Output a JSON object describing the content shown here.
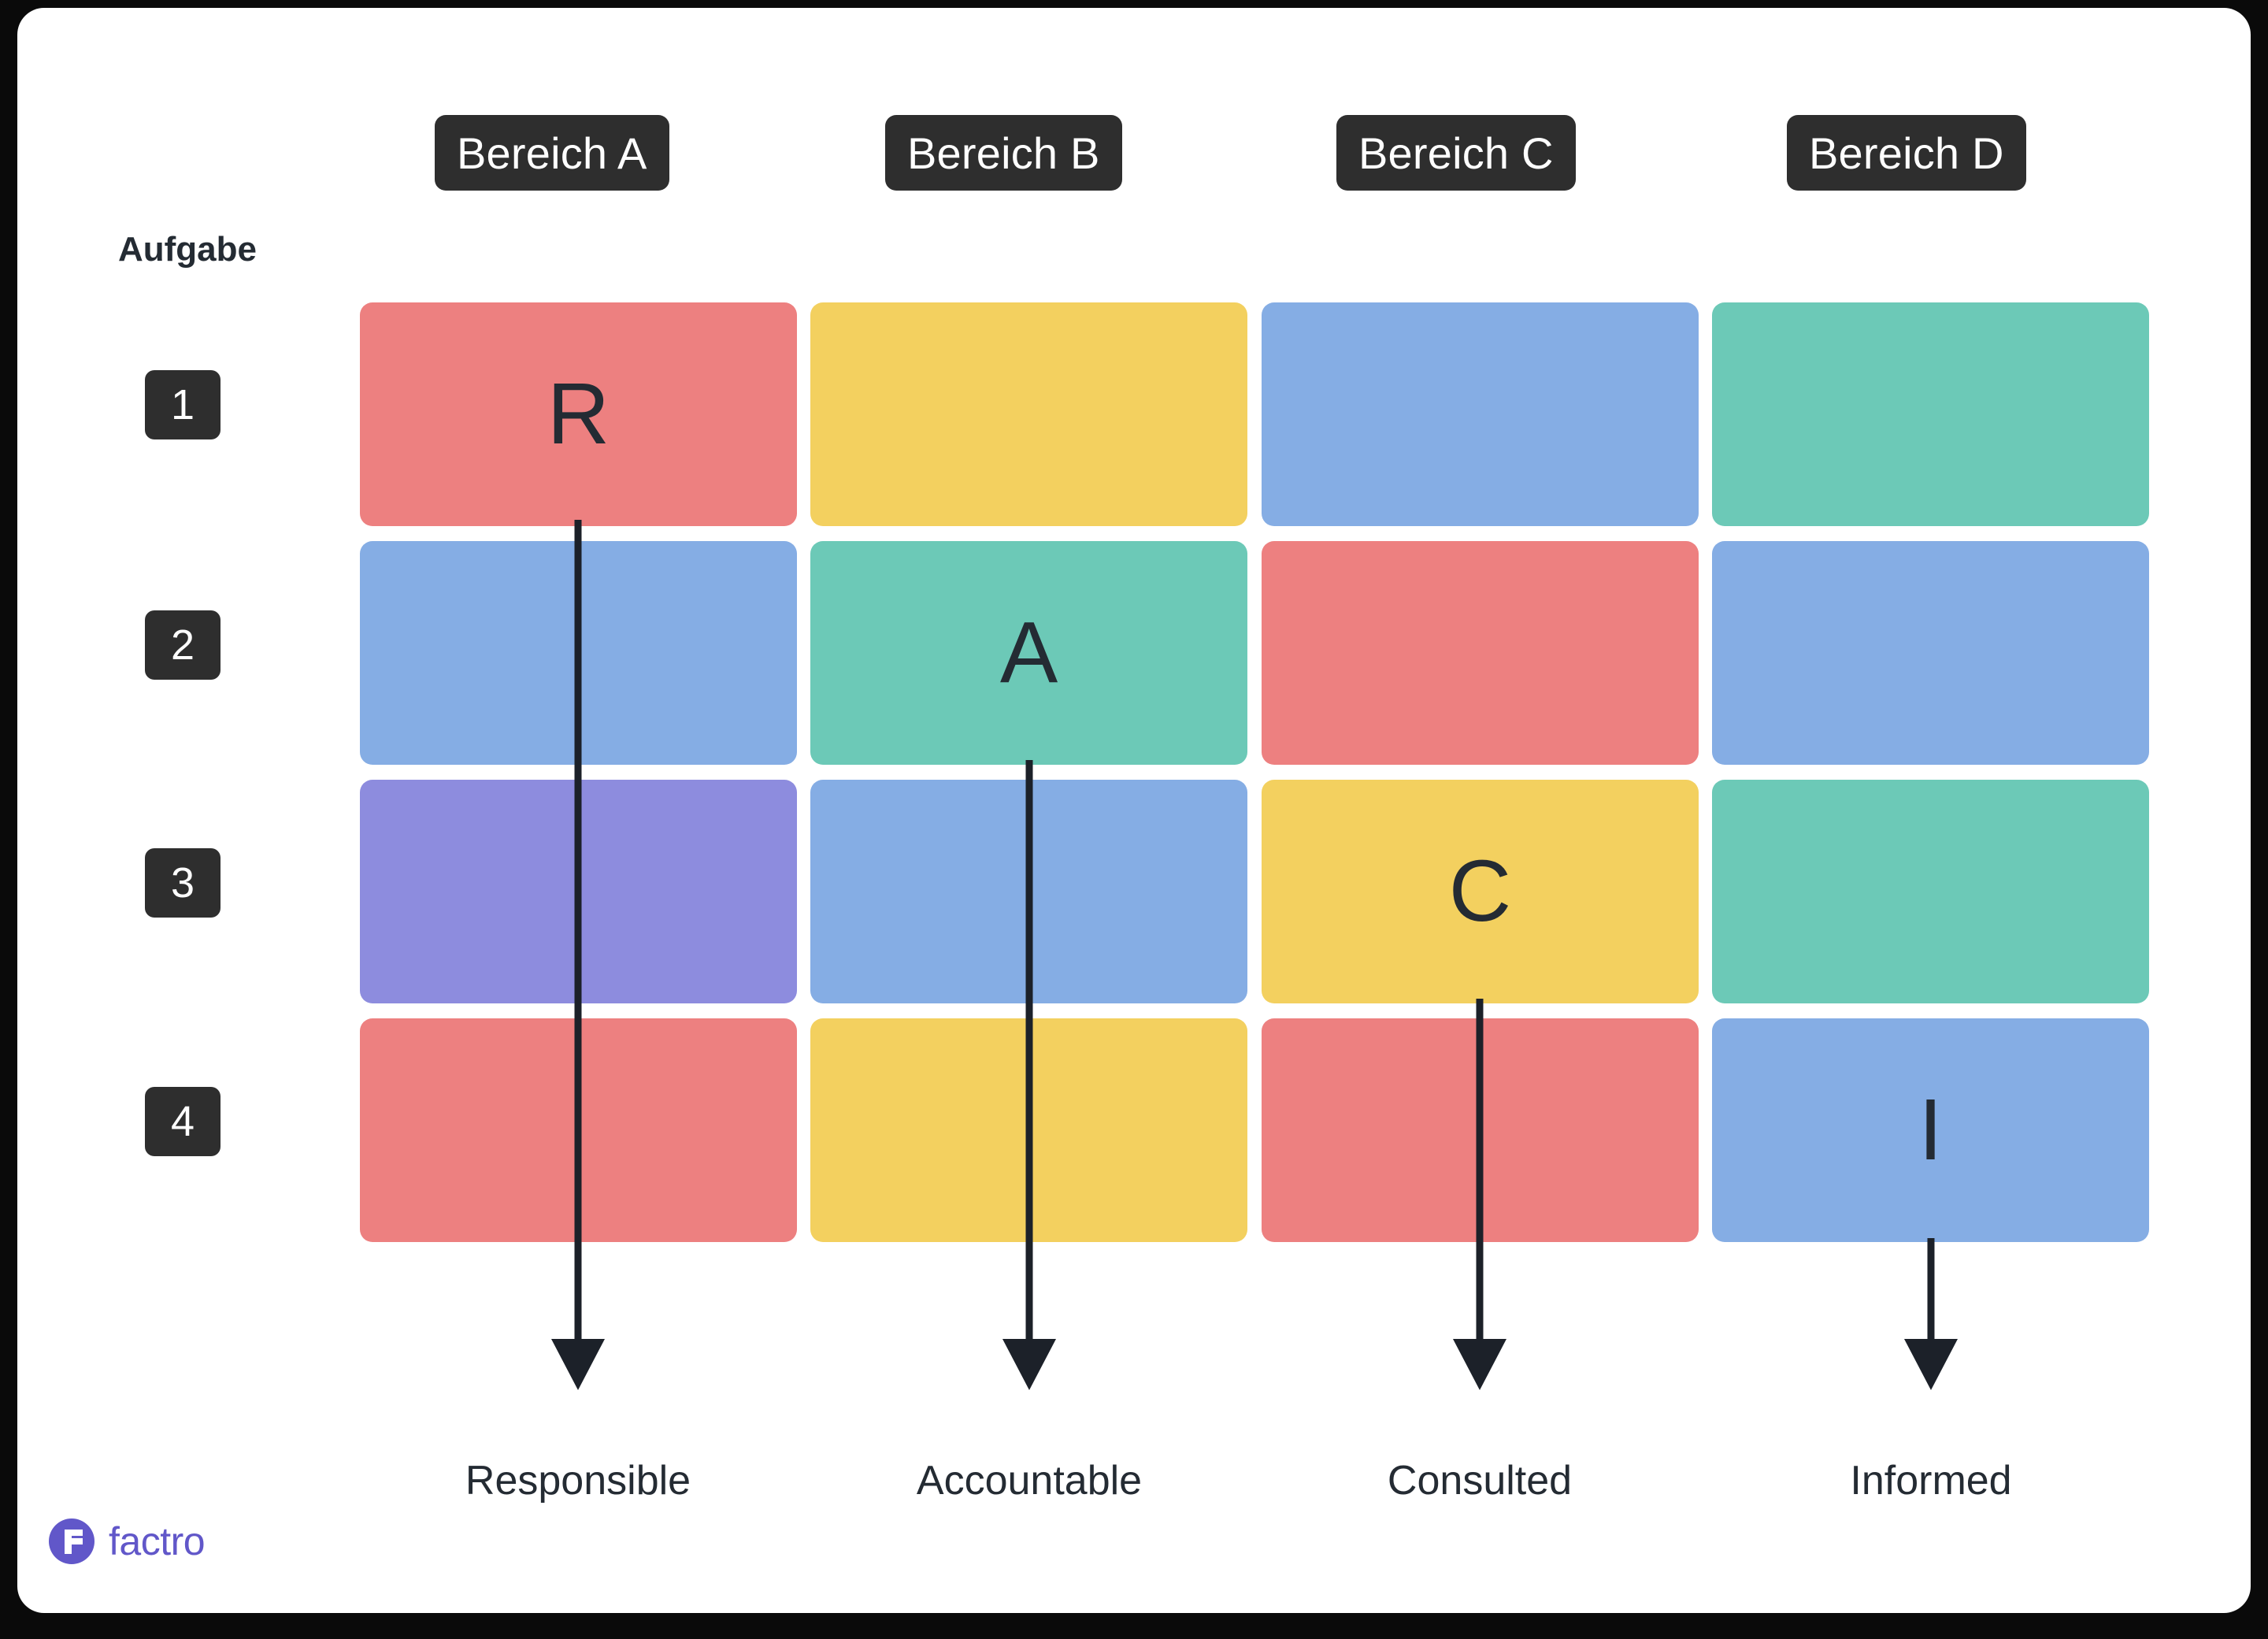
{
  "card": {
    "background": "#ffffff",
    "page_background": "#0a0a0a"
  },
  "header": {
    "row_axis_label": "Aufgabe",
    "columns": [
      {
        "label": "Bereich A"
      },
      {
        "label": "Bereich B"
      },
      {
        "label": "Bereich C"
      },
      {
        "label": "Bereich D"
      }
    ]
  },
  "rows": [
    {
      "badge": "1"
    },
    {
      "badge": "2"
    },
    {
      "badge": "3"
    },
    {
      "badge": "4"
    }
  ],
  "matrix": {
    "cells": [
      [
        {
          "color": "#ED8080",
          "letter": "R"
        },
        {
          "color": "#F3D05F",
          "letter": ""
        },
        {
          "color": "#85ADE4",
          "letter": ""
        },
        {
          "color": "#6CC9B7",
          "letter": ""
        }
      ],
      [
        {
          "color": "#85ADE4",
          "letter": ""
        },
        {
          "color": "#6CC9B7",
          "letter": "A"
        },
        {
          "color": "#ED8080",
          "letter": ""
        },
        {
          "color": "#85ADE4",
          "letter": ""
        }
      ],
      [
        {
          "color": "#8D8CDE",
          "letter": ""
        },
        {
          "color": "#85ADE4",
          "letter": ""
        },
        {
          "color": "#F3D05F",
          "letter": "C"
        },
        {
          "color": "#6CC9B7",
          "letter": ""
        }
      ],
      [
        {
          "color": "#ED8080",
          "letter": ""
        },
        {
          "color": "#F3D05F",
          "letter": ""
        },
        {
          "color": "#ED8080",
          "letter": ""
        },
        {
          "color": "#85ADE4",
          "letter": "I"
        }
      ]
    ]
  },
  "legend": [
    {
      "label": "Responsible"
    },
    {
      "label": "Accountable"
    },
    {
      "label": "Consulted"
    },
    {
      "label": "Informed"
    }
  ],
  "branding": {
    "logo_text": "factro",
    "logo_icon": "factro-f-icon",
    "logo_color": "#6157C9"
  },
  "palette": {
    "red": "#ED8080",
    "yellow": "#F3D05F",
    "blue": "#85ADE4",
    "teal": "#6CC9B7",
    "purple": "#8D8CDE",
    "dark": "#2e2e2e",
    "text_dark": "#242b33"
  }
}
